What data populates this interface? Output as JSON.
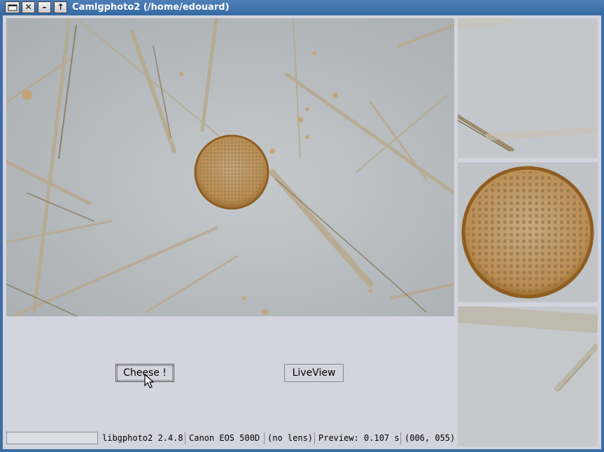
{
  "window": {
    "title": "Camlgphoto2 (/home/edouard)",
    "buttons": {
      "menu_icon": "window-menu-icon",
      "close_icon": "close-icon",
      "minimize_icon": "minimize-icon",
      "maximize_icon": "maximize-icon"
    },
    "colors": {
      "titlebar": "#3a6ea5",
      "client_bg": "#d4d4de"
    }
  },
  "buttons": {
    "cheese_label": "Cheese !",
    "liveview_label": "LiveView"
  },
  "statusbar": {
    "progress": 0,
    "library": "libgphoto2 2.4.8",
    "camera": "Canon EOS 500D",
    "lens": "(no lens)",
    "preview": "Preview: 0.107 s",
    "focus_point": "(006, 055)"
  }
}
